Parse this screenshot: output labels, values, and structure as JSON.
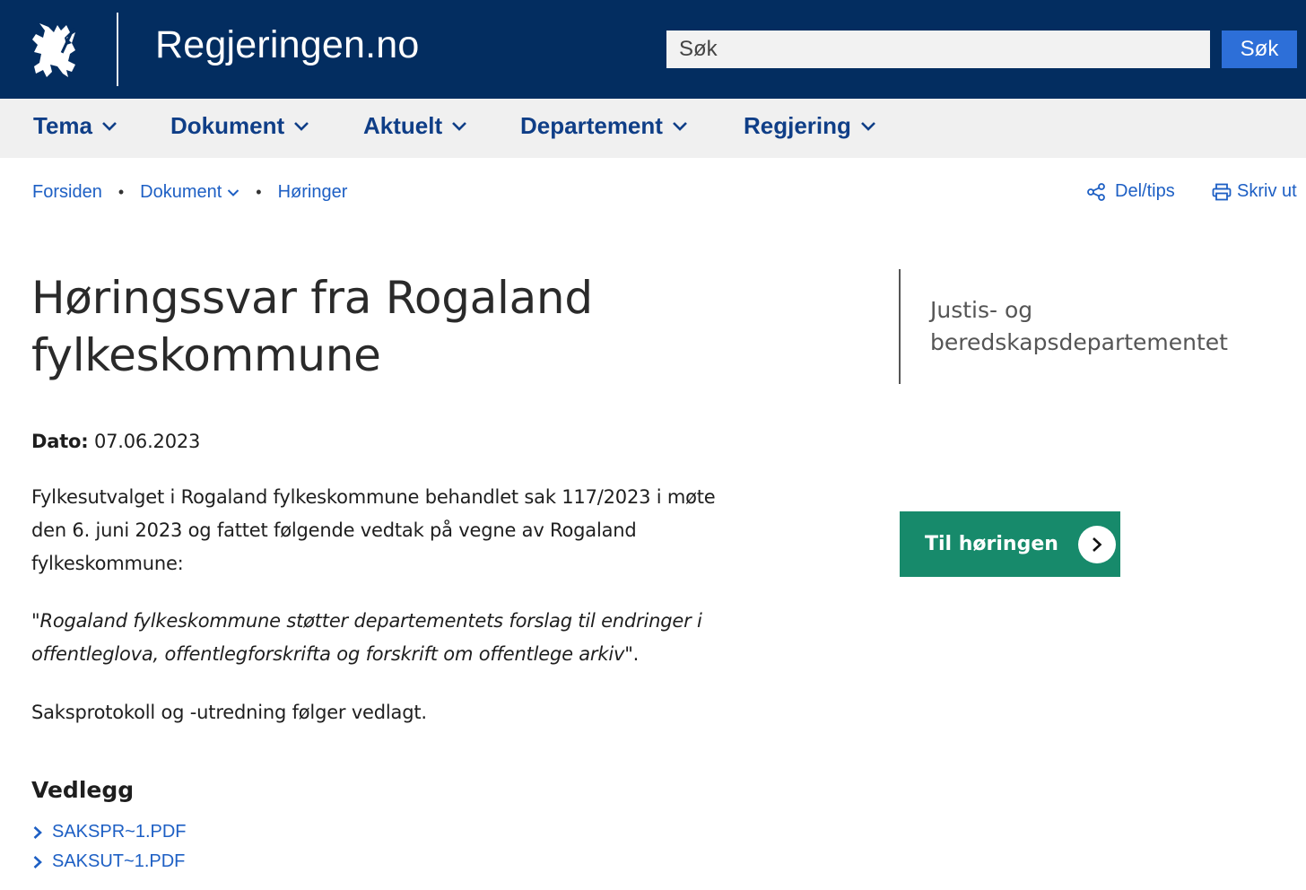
{
  "header": {
    "site_title": "Regjeringen.no",
    "search_placeholder": "Søk",
    "search_button": "Søk"
  },
  "nav": {
    "items": [
      {
        "label": "Tema"
      },
      {
        "label": "Dokument"
      },
      {
        "label": "Aktuelt"
      },
      {
        "label": "Departement"
      },
      {
        "label": "Regjering"
      }
    ]
  },
  "breadcrumb": {
    "items": [
      {
        "label": "Forsiden"
      },
      {
        "label": "Dokument"
      },
      {
        "label": "Høringer"
      }
    ]
  },
  "utilities": {
    "share": "Del/tips",
    "print": "Skriv ut"
  },
  "article": {
    "title": "Høringssvar fra Rogaland fylkeskommune",
    "date_label": "Dato:",
    "date_value": "07.06.2023",
    "paragraph1": "Fylkesutvalget i Rogaland fylkeskommune behandlet sak 117/2023 i møte den 6. juni 2023 og fattet følgende vedtak på vegne av Rogaland fylkeskommune:",
    "quote_open": "\"",
    "quote_text": "Rogaland fylkeskommune støtter departementets forslag til endringer i offentleglova, offentlegforskrifta og forskrift om offentlege arkiv",
    "quote_close": "\".",
    "paragraph3": "Saksprotokoll og -utredning følger vedlagt."
  },
  "sidebar": {
    "department": "Justis- og beredskapsdepartementet",
    "cta_label": "Til høringen"
  },
  "attachments": {
    "heading": "Vedlegg",
    "files": [
      {
        "name": "SAKSPR~1.PDF"
      },
      {
        "name": "SAKSUT~1.PDF"
      }
    ]
  },
  "colors": {
    "header_bg": "#032d60",
    "nav_bg": "#f0f0f0",
    "link": "#1d5fc4",
    "cta": "#178a6b",
    "search_button": "#2d6fd8"
  }
}
